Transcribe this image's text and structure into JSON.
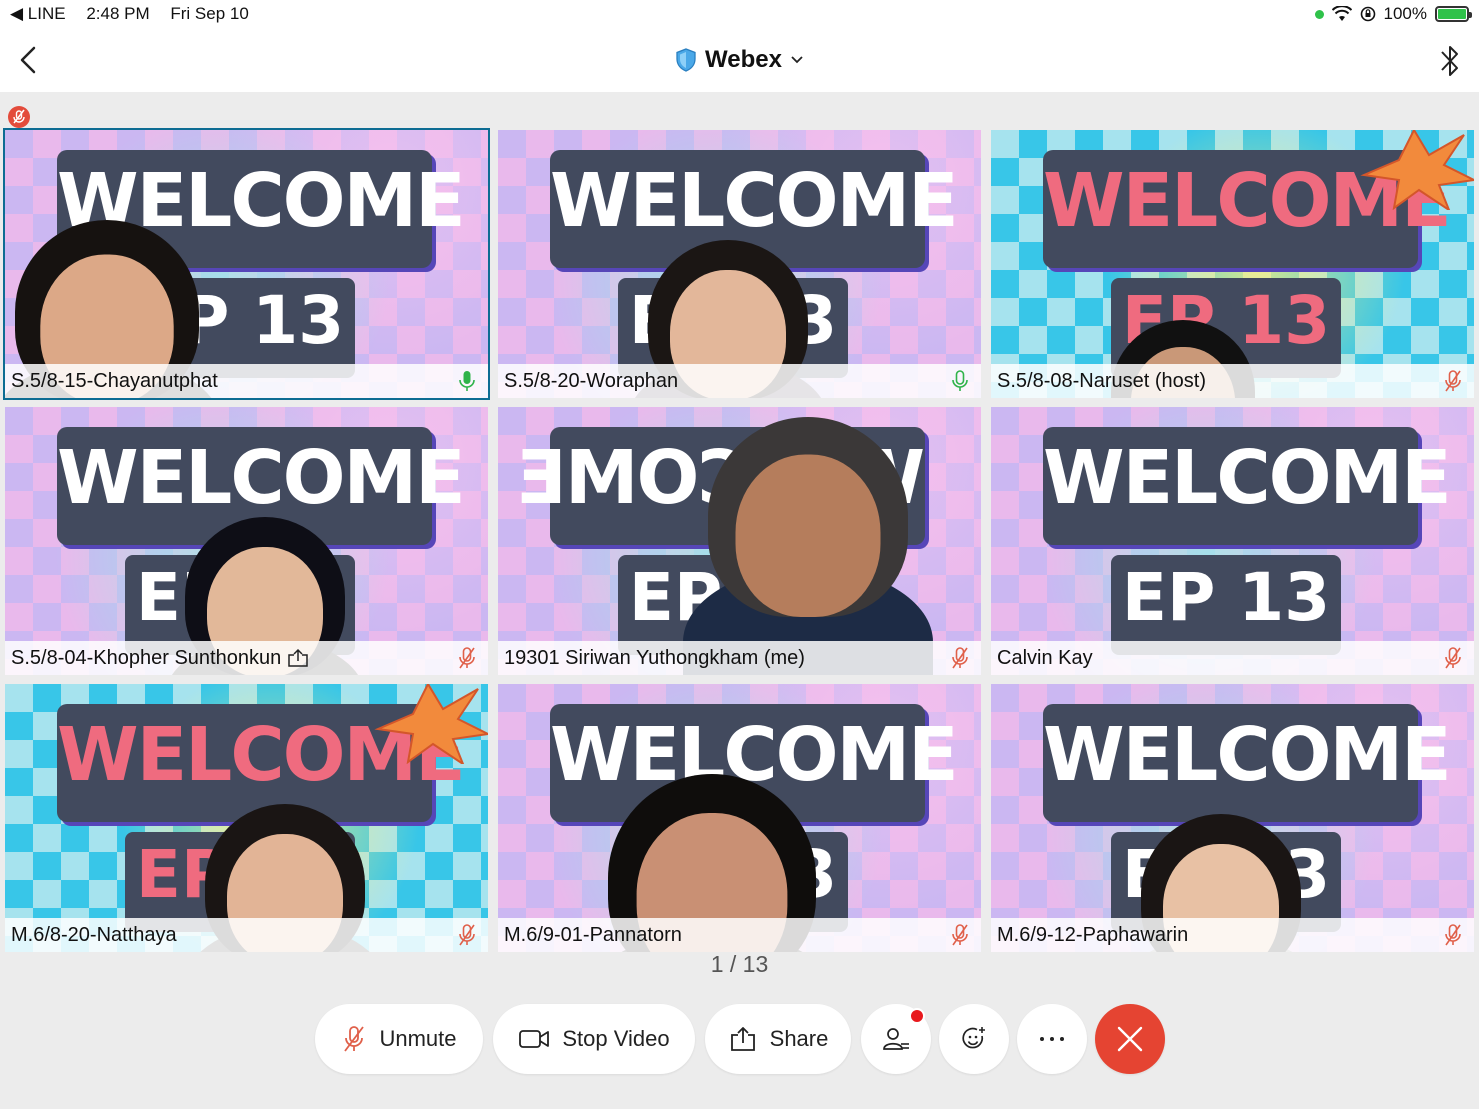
{
  "status_bar": {
    "back_app": "◀ LINE",
    "time": "2:48 PM",
    "date": "Fri Sep 10",
    "battery": "100%"
  },
  "nav": {
    "title": "Webex"
  },
  "participants": [
    {
      "name": "S.5/8-15-Chayanutphat",
      "audio": "speaking",
      "active": true,
      "background": "pastel",
      "banner": "WELCOME",
      "episode": "EP 13"
    },
    {
      "name": "S.5/8-20-Woraphan",
      "audio": "unmuted",
      "active": false,
      "background": "pastel",
      "banner": "WELCOME",
      "episode": "EP 13"
    },
    {
      "name": "S.5/8-08-Naruset (host)",
      "audio": "muted",
      "active": false,
      "background": "bright",
      "banner": "WELCOME",
      "episode": "EP 13"
    },
    {
      "name": "S.5/8-04-Khopher Sunthonkun",
      "audio": "muted",
      "active": false,
      "sharing": true,
      "background": "pastel",
      "banner": "WELCOME",
      "episode": "EP 13"
    },
    {
      "name": "19301 Siriwan Yuthongkham (me)",
      "audio": "muted",
      "active": false,
      "background": "pastel",
      "banner": "WELCOME",
      "episode": "EP 13",
      "mirrored": true
    },
    {
      "name": "Calvin Kay",
      "audio": "muted",
      "active": false,
      "background": "pastel",
      "banner": "WELCOME",
      "episode": "EP 13"
    },
    {
      "name": "M.6/8-20-Natthaya",
      "audio": "muted",
      "active": false,
      "background": "bright",
      "banner": "WELCOME",
      "episode": "EP 13"
    },
    {
      "name": "M.6/9-01-Pannatorn",
      "audio": "muted",
      "active": false,
      "background": "pastel",
      "banner": "WELCOME",
      "episode": "EP 13"
    },
    {
      "name": "M.6/9-12-Paphawarin",
      "audio": "muted",
      "active": false,
      "background": "pastel",
      "banner": "WELCOME",
      "episode": "EP 13"
    }
  ],
  "pager": {
    "text": "1 / 13"
  },
  "controls": {
    "unmute_label": "Unmute",
    "stop_video_label": "Stop Video",
    "share_label": "Share",
    "participants_icon": "participants-icon",
    "reactions_icon": "reactions-icon",
    "more_icon": "more-icon",
    "leave_icon": "close-icon"
  },
  "colors": {
    "accent": "#0d6c93",
    "leave": "#e54432",
    "mic_active": "#2fb34a",
    "mic_muted": "#e0604a",
    "notification": "#e8191d"
  }
}
